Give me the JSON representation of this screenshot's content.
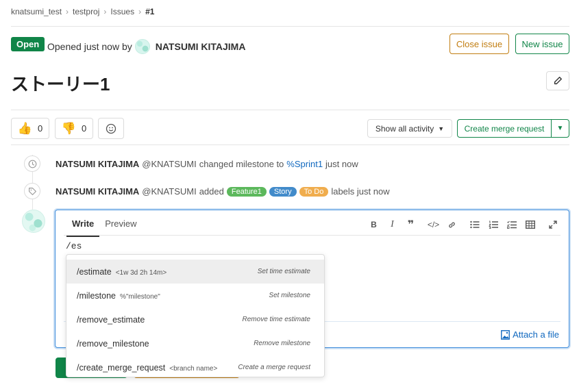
{
  "breadcrumb": [
    "knatsumi_test",
    "testproj",
    "Issues",
    "#1"
  ],
  "header": {
    "status": "Open",
    "opened_text": "Opened just now by",
    "author": "NATSUMI KITAJIMA",
    "close_label": "Close issue",
    "new_label": "New issue"
  },
  "issue": {
    "title": "ストーリー1"
  },
  "awards": {
    "thumbs_up_count": "0",
    "thumbs_down_count": "0"
  },
  "activity": {
    "show_all": "Show all activity",
    "create_mr": "Create merge request"
  },
  "notes": [
    {
      "author": "NATSUMI KITAJIMA",
      "handle": "@KNATSUMI",
      "action": "changed milestone to",
      "link": "%Sprint1",
      "time": "just now"
    },
    {
      "author": "NATSUMI KITAJIMA",
      "handle": "@KNATSUMI",
      "action": "added",
      "labels": [
        {
          "text": "Feature1",
          "color": "#5cb85c"
        },
        {
          "text": "Story",
          "color": "#428bca"
        },
        {
          "text": "To Do",
          "color": "#f0ad4e"
        }
      ],
      "suffix": "labels just now"
    }
  ],
  "editor": {
    "tab_write": "Write",
    "tab_preview": "Preview",
    "text": "/es",
    "attach": "Attach a file"
  },
  "autocomplete": [
    {
      "cmd": "/estimate",
      "param": "<1w 3d 2h 14m>",
      "desc": "Set time estimate"
    },
    {
      "cmd": "/milestone",
      "param": "%\"milestone\"",
      "desc": "Set milestone"
    },
    {
      "cmd": "/remove_estimate",
      "param": "",
      "desc": "Remove time estimate"
    },
    {
      "cmd": "/remove_milestone",
      "param": "",
      "desc": "Remove milestone"
    },
    {
      "cmd": "/create_merge_request",
      "param": "<branch name>",
      "desc": "Create a merge request"
    }
  ],
  "colors": {
    "green": "#108548",
    "orange": "#c17d10",
    "link": "#1068bf"
  }
}
